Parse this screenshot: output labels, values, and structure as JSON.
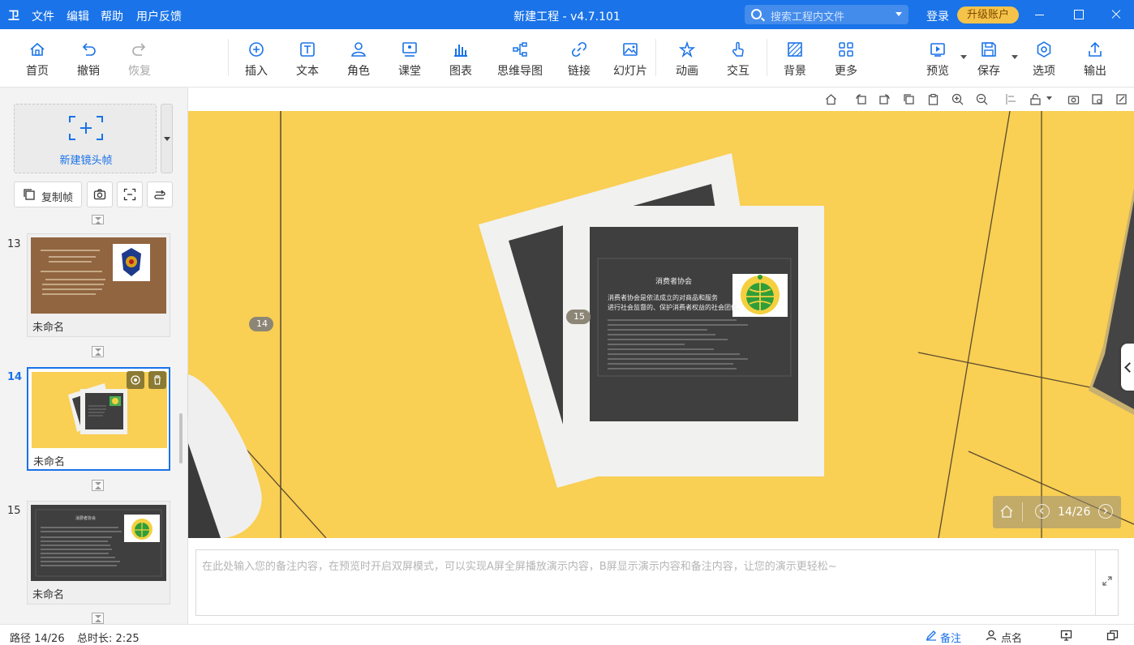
{
  "titlebar": {
    "logo": "卫",
    "menu": [
      "文件",
      "编辑",
      "帮助",
      "用户反馈"
    ],
    "app_title": "新建工程 - v4.7.101",
    "search_placeholder": "搜索工程内文件",
    "login": "登录",
    "upgrade": "升级账户"
  },
  "toolbar": {
    "home": "首页",
    "undo": "撤销",
    "redo": "恢复",
    "insert": "插入",
    "text": "文本",
    "role": "角色",
    "classroom": "课堂",
    "chart": "图表",
    "mindmap": "思维导图",
    "link": "链接",
    "slideshow": "幻灯片",
    "animation": "动画",
    "interaction": "交互",
    "background": "背景",
    "more": "更多",
    "preview": "预览",
    "save": "保存",
    "options": "选项",
    "export": "输出"
  },
  "sidebar": {
    "new_frame": "新建镜头帧",
    "copy_frame": "复制帧",
    "slides": [
      {
        "num": "13",
        "name": "未命名"
      },
      {
        "num": "14",
        "name": "未命名"
      },
      {
        "num": "15",
        "name": "未命名"
      }
    ]
  },
  "slide_content": {
    "title": "消费者协会",
    "line1": "消费者协会是依法成立的对商品和服务",
    "line2": "进行社会监督的、保护消费者权益的社会团体。"
  },
  "canvas": {
    "badge_left": "14",
    "badge_center": "15",
    "nav_counter": "14/26"
  },
  "notes": {
    "placeholder": "在此处输入您的备注内容，在预览时开启双屏模式，可以实现A屏全屏播放演示内容，B屏显示演示内容和备注内容，让您的演示更轻松~"
  },
  "statusbar": {
    "path": "路径 14/26",
    "duration": "总时长: 2:25",
    "notes": "备注",
    "rollcall": "点名"
  },
  "colors": {
    "accent": "#1a73e8",
    "canvas_bg": "#f9cf54",
    "upgrade_bg": "#f6c34a",
    "slide_dark": "#3f3f40",
    "frame_white": "#f1f1ef"
  }
}
